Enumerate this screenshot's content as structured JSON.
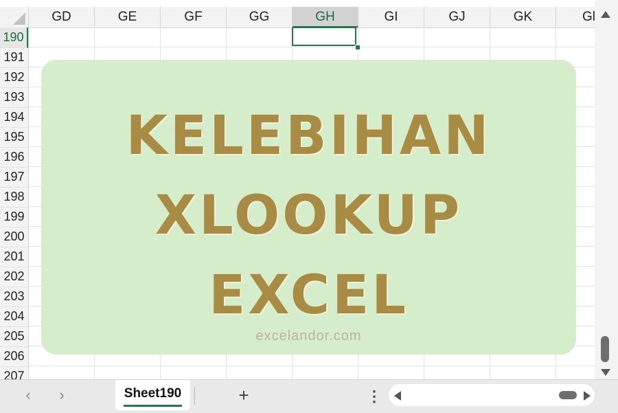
{
  "columns": [
    {
      "label": "GD",
      "selected": false
    },
    {
      "label": "GE",
      "selected": false
    },
    {
      "label": "GF",
      "selected": false
    },
    {
      "label": "GG",
      "selected": false
    },
    {
      "label": "GH",
      "selected": true
    },
    {
      "label": "GI",
      "selected": false
    },
    {
      "label": "GJ",
      "selected": false
    },
    {
      "label": "GK",
      "selected": false
    },
    {
      "label": "Gl",
      "selected": false
    }
  ],
  "rows": [
    "190",
    "191",
    "192",
    "193",
    "194",
    "195",
    "196",
    "197",
    "198",
    "199",
    "200",
    "201",
    "202",
    "203",
    "204",
    "205",
    "206",
    "207"
  ],
  "active_cell": {
    "column": "GH",
    "row": "190"
  },
  "banner": {
    "title_lines": [
      "KELEBIHAN",
      "XLOOKUP",
      "EXCEL"
    ],
    "website": "excelandor.com"
  },
  "sheet_bar": {
    "active_sheet": "Sheet190",
    "add_sheet_symbol": "+",
    "more_symbol": "⋮",
    "prev_symbol": "‹",
    "next_symbol": "›"
  },
  "colors": {
    "accent_green": "#1f7a45",
    "banner_bg": "#d3ecc8",
    "banner_text": "#a88b45"
  }
}
